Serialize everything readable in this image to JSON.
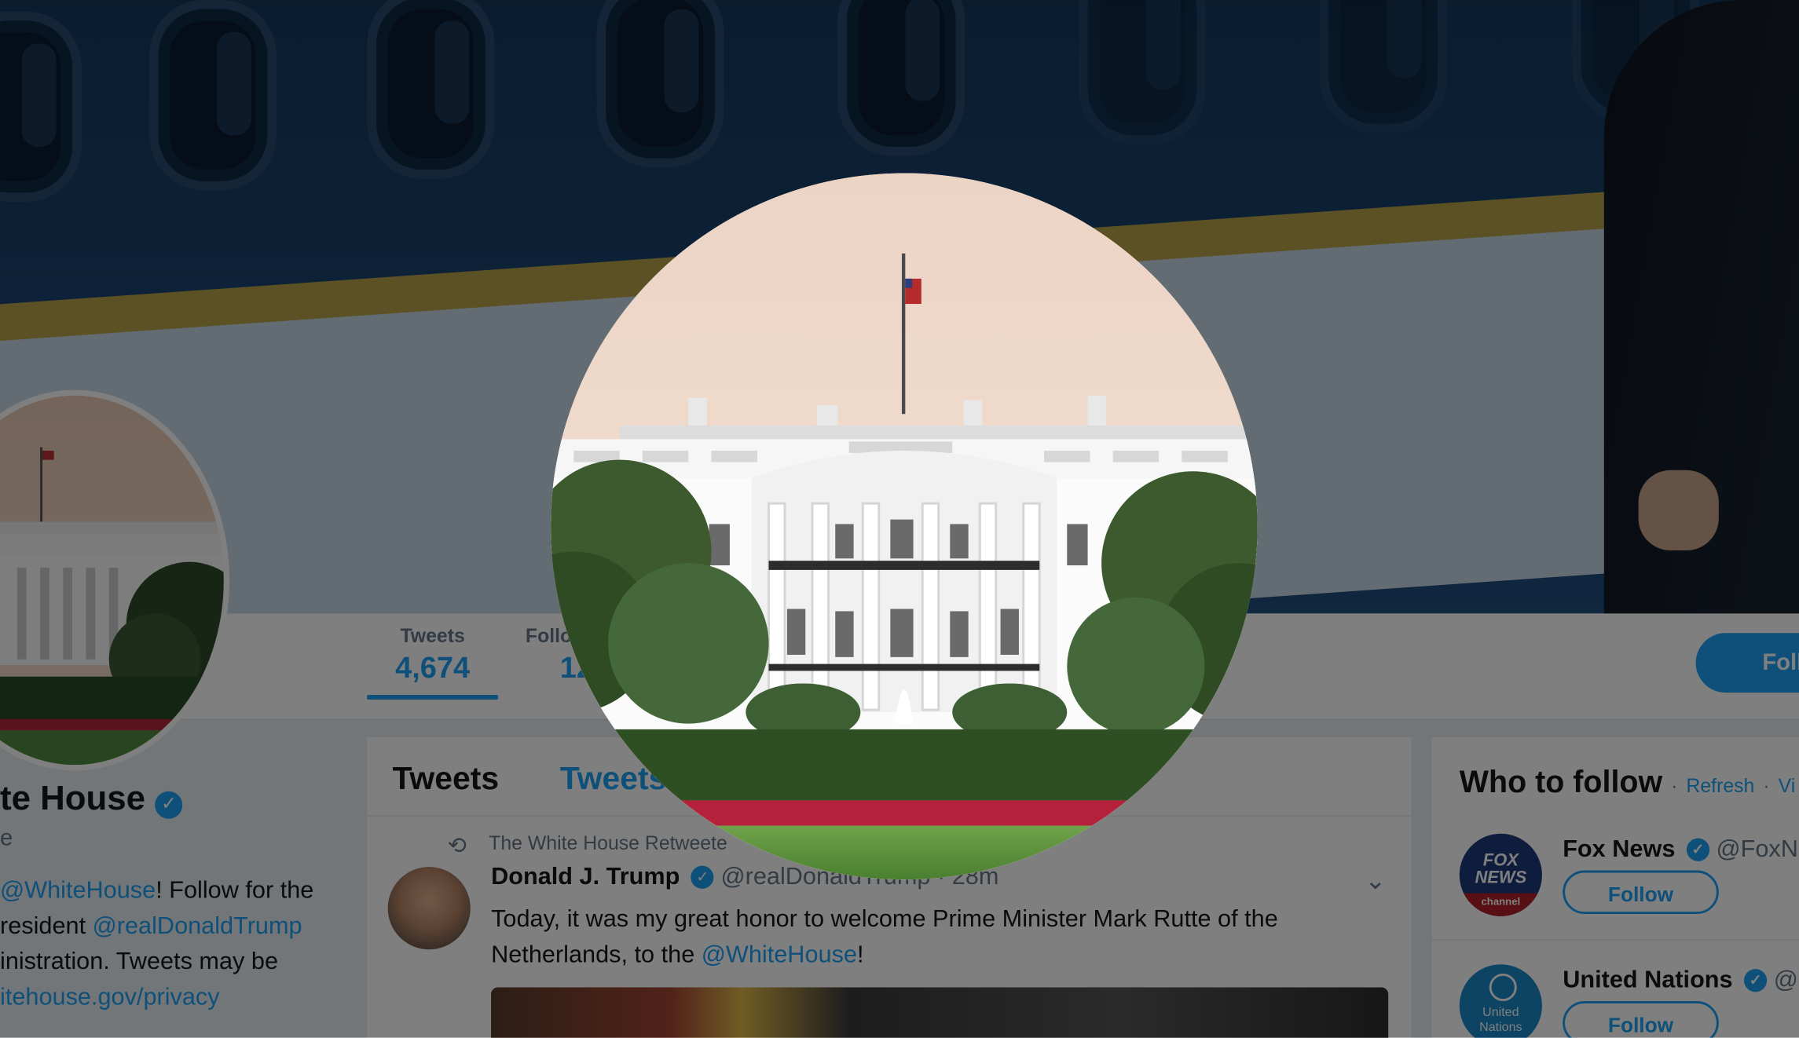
{
  "colors": {
    "accent": "#1da1f2",
    "text": "#14171a",
    "muted": "#657786",
    "overlay": "rgba(0,0,0,0.5)"
  },
  "profile": {
    "name_visible": "te House",
    "handle_fragment": "e",
    "bio": {
      "line1_link": "@WhiteHouse",
      "line1_rest": "! Follow for the",
      "line2_pre": "resident ",
      "line2_link": "@realDonaldTrump",
      "line3": "inistration. Tweets may be",
      "line4_link": "itehouse.gov/privacy"
    }
  },
  "nav": {
    "tweets_label": "Tweets",
    "tweets_count": "4,674",
    "following_label": "Follo",
    "following_count": "12",
    "follow_button": "Follo"
  },
  "timeline": {
    "tabs": [
      "Tweets",
      "Tweets"
    ],
    "retweet_note": "The White House Retweete",
    "tweet": {
      "author": "Donald J. Trump",
      "handle": "@realDonaldTrump",
      "time": "28m",
      "text_pre": "Today, it was my great honor to welcome Prime Minister Mark Rutte of the Netherlands, to the ",
      "text_link": "@WhiteHouse",
      "text_post": "!"
    },
    "icons": {
      "retweet": "retweet-icon",
      "verified": "verified-badge-icon",
      "caret": "chevron-down-icon"
    }
  },
  "who_to_follow": {
    "title": "Who to follow",
    "refresh": "Refresh",
    "view_all": "Vi",
    "accounts": [
      {
        "name": "Fox News",
        "handle": "@FoxN",
        "follow": "Follow",
        "avatar_text": "FOX NEWS",
        "avatar_sub": "channel"
      },
      {
        "name": "United Nations",
        "handle": "@",
        "follow": "Follow",
        "avatar_text": "United Nations"
      }
    ]
  }
}
